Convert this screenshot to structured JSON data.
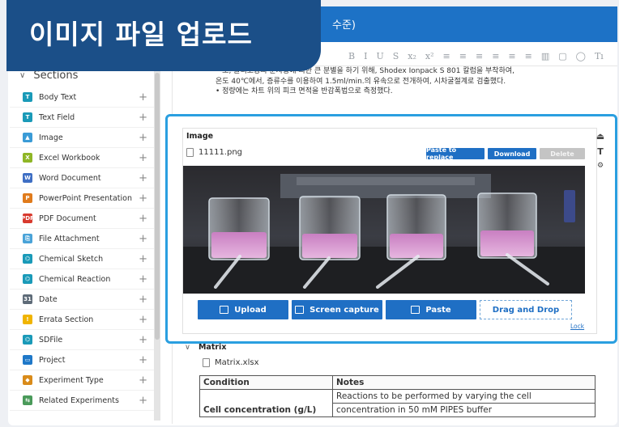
{
  "banner": {
    "title": "이미지 파일 업로드"
  },
  "header": {
    "title_fragment": "수준)"
  },
  "toolbar": {
    "items": [
      "B",
      "I",
      "U",
      "S",
      "x₂",
      "x²",
      "≡",
      "≡",
      "≡",
      "≡",
      "≡",
      "≡",
      "▥",
      "▢",
      "◯",
      "Tı"
    ]
  },
  "sidebar": {
    "header": "Sections",
    "items": [
      {
        "label": "Body Text",
        "icon": "text-icon",
        "color": "#1a9ab8",
        "glyph": "T"
      },
      {
        "label": "Text Field",
        "icon": "text-field-icon",
        "color": "#1a9ab8",
        "glyph": "T"
      },
      {
        "label": "Image",
        "icon": "image-icon",
        "color": "#3a9bd6",
        "glyph": "▲"
      },
      {
        "label": "Excel Workbook",
        "icon": "excel-icon",
        "color": "#8fb626",
        "glyph": "X"
      },
      {
        "label": "Word Document",
        "icon": "word-icon",
        "color": "#3f6fc4",
        "glyph": "W"
      },
      {
        "label": "PowerPoint Presentation",
        "icon": "powerpoint-icon",
        "color": "#e07b1c",
        "glyph": "P"
      },
      {
        "label": "PDF Document",
        "icon": "pdf-icon",
        "color": "#d83a2e",
        "glyph": "PDF"
      },
      {
        "label": "File Attachment",
        "icon": "attachment-icon",
        "color": "#4aa3d8",
        "glyph": "⎘"
      },
      {
        "label": "Chemical Sketch",
        "icon": "chemical-sketch-icon",
        "color": "#1a9ab8",
        "glyph": "⌬"
      },
      {
        "label": "Chemical Reaction",
        "icon": "chemical-reaction-icon",
        "color": "#1a9ab8",
        "glyph": "⌬"
      },
      {
        "label": "Date",
        "icon": "calendar-icon",
        "color": "#5e6b78",
        "glyph": "31"
      },
      {
        "label": "Errata Section",
        "icon": "warning-icon",
        "color": "#f0b400",
        "glyph": "!"
      },
      {
        "label": "SDFile",
        "icon": "sdfile-icon",
        "color": "#1a9ab8",
        "glyph": "⌬"
      },
      {
        "label": "Project",
        "icon": "folder-icon",
        "color": "#1f78c8",
        "glyph": "▭"
      },
      {
        "label": "Experiment Type",
        "icon": "tag-icon",
        "color": "#d98b1a",
        "glyph": "◆"
      },
      {
        "label": "Related Experiments",
        "icon": "related-icon",
        "color": "#4a9a5a",
        "glyph": "⇆"
      }
    ]
  },
  "editor": {
    "lines": [
      "• 또, 올리고당의 분자량에 의한 큰 분별을 하기 위해, Shodex Ionpack S 801 칼럼을 부착하여,",
      "  온도 40℃에서, 증류수를 이용하여 1.5ml/min.의 유속으로 전개하여, 시차굴절계로 검출했다.",
      "• 정량에는 차트 위의 피크 면적을 반감폭법으로 측정했다."
    ]
  },
  "image_section": {
    "heading": "Image",
    "filename": "11111.png",
    "paste_to_replace": "Paste to replace",
    "download": "Download",
    "delete": "Delete",
    "upload": "Upload",
    "screen_capture": "Screen capture",
    "paste": "Paste",
    "drag_and_drop": "Drag and Drop",
    "lock": "Lock"
  },
  "matrix": {
    "heading": "Matrix",
    "filename": "Matrix.xlsx",
    "columns": [
      "Condition",
      "Notes"
    ],
    "rows": [
      {
        "condition": "Cell concentration (g/L)",
        "notes_line1": "Reactions to be performed by varying the cell",
        "notes_line2": "concentration in 50 mM PIPES buffer"
      }
    ]
  }
}
